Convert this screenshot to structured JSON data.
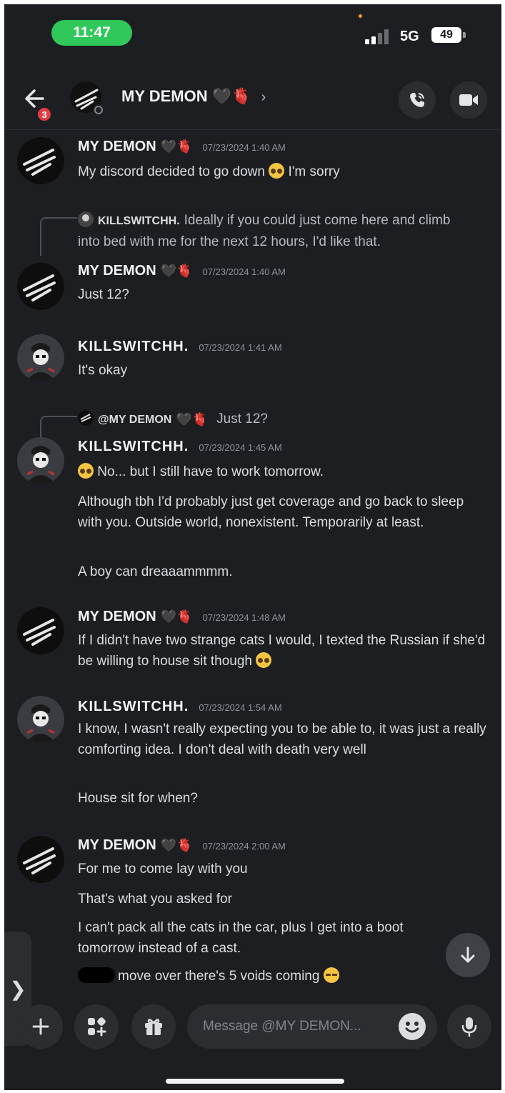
{
  "status_bar": {
    "time": "11:47",
    "network": "5G",
    "battery": "49"
  },
  "header": {
    "title": "MY DEMON",
    "badge_count": "3",
    "chevron": "›"
  },
  "emoji": {
    "black_heart": "🖤",
    "anatomical_heart": "🫀"
  },
  "messages": [
    {
      "author": "MY DEMON",
      "timestamp": "07/23/2024 1:40 AM",
      "lines": [
        "My discord decided to go down",
        "I'm sorry"
      ]
    },
    {
      "reply_to": {
        "author": "KILLSWITCHH.",
        "text": "Ideally if you could just come here and climb into bed with me for the next 12 hours, I'd like that."
      },
      "author": "MY DEMON",
      "timestamp": "07/23/2024 1:40 AM",
      "lines": [
        "Just 12?"
      ]
    },
    {
      "author": "KILLSWITCHH.",
      "timestamp": "07/23/2024 1:41 AM",
      "lines": [
        "It's okay"
      ]
    },
    {
      "reply_to": {
        "author": "@MY DEMON",
        "text": "Just 12?"
      },
      "author": "KILLSWITCHH.",
      "timestamp": "07/23/2024 1:45 AM",
      "lines": [
        "No... but I still have to work tomorrow.",
        "Although tbh I'd probably just get coverage and go back to sleep with you. Outside world, nonexistent. Temporarily at least.",
        "A boy can dreaaammmm."
      ]
    },
    {
      "author": "MY DEMON",
      "timestamp": "07/23/2024 1:48 AM",
      "lines": [
        "If I didn't have two strange cats I would, I texted the Russian if she'd be willing to house sit though"
      ]
    },
    {
      "author": "KILLSWITCHH.",
      "timestamp": "07/23/2024 1:54 AM",
      "lines": [
        "I know, I wasn't really expecting you to be able to, it was just a really comforting idea. I don't deal with death very well",
        "House sit for when?"
      ]
    },
    {
      "author": "MY DEMON",
      "timestamp": "07/23/2024 2:00 AM",
      "lines": [
        "For me to come lay with you",
        "That's what you asked for",
        "I can't pack all the cats in the car, plus I get into a boot tomorrow instead of a cast.",
        "move over there's 5 voids coming"
      ]
    }
  ],
  "composer": {
    "placeholder": "Message @MY DEMON..."
  },
  "side_tab_glyph": "❯",
  "icons": [
    "back-arrow-icon",
    "phone-icon",
    "video-icon",
    "plus-icon",
    "apps-icon",
    "gift-icon",
    "emoji-icon",
    "mic-icon",
    "arrow-down-icon"
  ],
  "colors": {
    "background": "#1d1e22",
    "badge": "#e23c40",
    "time_pill": "#30c85a",
    "surface": "#2b2d31"
  }
}
